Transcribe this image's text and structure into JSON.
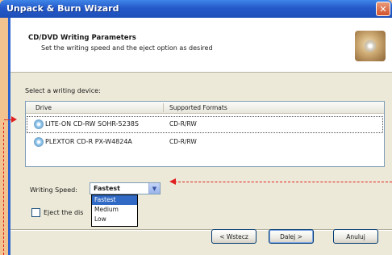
{
  "window": {
    "title": "Unpack & Burn Wizard",
    "close_glyph": "✕"
  },
  "header": {
    "title": "CD/DVD Writing Parameters",
    "subtitle": "Set the writing speed and the eject option as desired",
    "icon": "disc-icon"
  },
  "device": {
    "label": "Select a writing device:",
    "columns": [
      "Drive",
      "Supported Formats"
    ],
    "rows": [
      {
        "drive": "LITE-ON CD-RW SOHR-5238S",
        "formats": "CD-R/RW",
        "selected": true
      },
      {
        "drive": "PLEXTOR CD-R   PX-W4824A",
        "formats": "CD-R/RW",
        "selected": false
      }
    ]
  },
  "speed": {
    "label": "Writing Speed:",
    "value": "Fastest",
    "arrow_glyph": "▼",
    "options": [
      "Fastest",
      "Medium",
      "Low"
    ]
  },
  "eject": {
    "label": "Eject the dis"
  },
  "buttons": {
    "back": "< Wstecz",
    "next": "Dalej >",
    "cancel": "Anuluj"
  },
  "colors": {
    "titlebar": "#2459c9",
    "annotation": "#e02020",
    "highlight": "#316ac5",
    "background": "#f2c28f"
  }
}
